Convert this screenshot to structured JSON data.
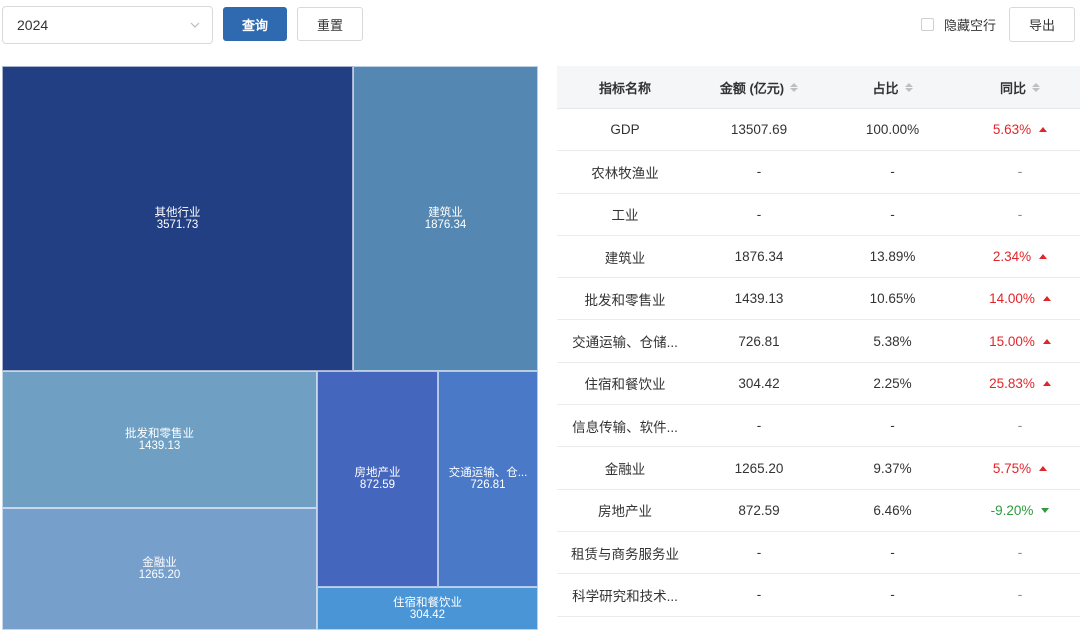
{
  "toolbar": {
    "year_value": "2024",
    "query_label": "查询",
    "reset_label": "重置",
    "hide_empty_label": "隐藏空行",
    "export_label": "导出"
  },
  "colors": {
    "primary": "#2f69b0",
    "up": "#e0262b",
    "down": "#2f9a3e"
  },
  "chart_data": {
    "type": "treemap",
    "items": [
      {
        "name": "其他行业",
        "label": "其他行业",
        "value": 3571.73,
        "color": "#233f84"
      },
      {
        "name": "建筑业",
        "label": "建筑业",
        "value": 1876.34,
        "color": "#5488b3"
      },
      {
        "name": "批发和零售业",
        "label": "批发和零售业",
        "value": 1439.13,
        "color": "#6f9fc3"
      },
      {
        "name": "金融业",
        "label": "金融业",
        "value": 1265.2,
        "color": "#779fcb"
      },
      {
        "name": "房地产业",
        "label": "房地产业",
        "value": 872.59,
        "color": "#4466bc"
      },
      {
        "name": "交通运输、仓储和邮政业",
        "label": "交通运输、仓...",
        "value": 726.81,
        "color": "#4a79c8"
      },
      {
        "name": "住宿和餐饮业",
        "label": "住宿和餐饮业",
        "value": 304.42,
        "color": "#4a95d6"
      }
    ]
  },
  "table": {
    "columns": [
      "指标名称",
      "金额 (亿元)",
      "占比",
      "同比"
    ],
    "rows": [
      {
        "name": "GDP",
        "amount": "13507.69",
        "share": "100.00%",
        "yoy": "5.63%",
        "dir": "up"
      },
      {
        "name": "农林牧渔业",
        "amount": "-",
        "share": "-",
        "yoy": "-",
        "dir": ""
      },
      {
        "name": "工业",
        "amount": "-",
        "share": "-",
        "yoy": "-",
        "dir": ""
      },
      {
        "name": "建筑业",
        "amount": "1876.34",
        "share": "13.89%",
        "yoy": "2.34%",
        "dir": "up"
      },
      {
        "name": "批发和零售业",
        "amount": "1439.13",
        "share": "10.65%",
        "yoy": "14.00%",
        "dir": "up"
      },
      {
        "name": "交通运输、仓储...",
        "amount": "726.81",
        "share": "5.38%",
        "yoy": "15.00%",
        "dir": "up"
      },
      {
        "name": "住宿和餐饮业",
        "amount": "304.42",
        "share": "2.25%",
        "yoy": "25.83%",
        "dir": "up"
      },
      {
        "name": "信息传输、软件...",
        "amount": "-",
        "share": "-",
        "yoy": "-",
        "dir": ""
      },
      {
        "name": "金融业",
        "amount": "1265.20",
        "share": "9.37%",
        "yoy": "5.75%",
        "dir": "up"
      },
      {
        "name": "房地产业",
        "amount": "872.59",
        "share": "6.46%",
        "yoy": "-9.20%",
        "dir": "down"
      },
      {
        "name": "租赁与商务服务业",
        "amount": "-",
        "share": "-",
        "yoy": "-",
        "dir": ""
      },
      {
        "name": "科学研究和技术...",
        "amount": "-",
        "share": "-",
        "yoy": "-",
        "dir": ""
      }
    ]
  }
}
